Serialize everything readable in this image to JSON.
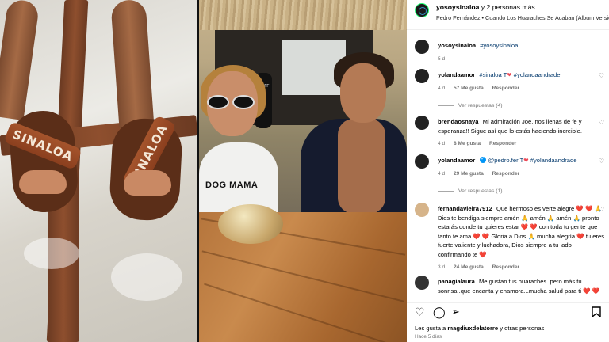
{
  "header": {
    "account": "yosoysinaloa",
    "others": "y 2 personas más",
    "audio": "Pedro Fernández • Cuando Los Huaraches Se Acaban (Album Version)"
  },
  "caption": {
    "user": "yosoysinaloa",
    "text": "#yosoysinaloa",
    "time": "5 d"
  },
  "comments": [
    {
      "user": "yolandaamor",
      "text_a": "#sinaloa T",
      "text_b": "#yolandaandrade",
      "time": "4 d",
      "likes": "57 Me gusta",
      "reply": "Responder",
      "replies": "Ver respuestas (4)"
    },
    {
      "user": "brendaosnaya",
      "text": "Mi admiración Joe, nos llenas de fe y esperanza!! Sigue así que lo estás haciendo increible.",
      "time": "4 d",
      "likes": "8 Me gusta",
      "reply": "Responder"
    },
    {
      "user": "yolandaamor",
      "text_a": "@pedro.fer T",
      "text_b": "#yolandaandrade",
      "time": "4 d",
      "likes": "29 Me gusta",
      "reply": "Responder",
      "replies": "Ver respuestas (1)"
    },
    {
      "user": "fernandavieira7912",
      "text": "Que hermoso es verte alegre ❤️ ❤️ 🙏 Dios te bendiga siempre amén 🙏 amén 🙏 amén 🙏 pronto estarás donde tu quieres estar ❤️ ❤️ con toda tu gente que tanto te ama ❤️ ❤️ Gloria a Dios 🙏 mucha alegría ❤️ tu eres fuerte valiente y luchadora, Dios siempre a tu lado confirmando te ❤️",
      "time": "3 d",
      "likes": "24 Me gusta",
      "reply": "Responder"
    },
    {
      "user": "panagialaura",
      "text": "Me gustan tus huaraches..pero más tu sonrisa..que encanta y enamora...mucha salud para ti ❤️ ❤️ ❤️ ❤️ ❤️"
    }
  ],
  "actions": {
    "like_icon": "heart-icon",
    "comment_icon": "comment-icon",
    "share_icon": "share-icon",
    "save_icon": "bookmark-icon"
  },
  "likes_line": {
    "prefix": "Les gusta a",
    "user": "magdiuxdelatorre",
    "suffix": "y otras personas"
  },
  "posted": "Hace 5 días",
  "media": {
    "sandal_left_text": "SINALOA",
    "sandal_right_text": "SINALOA",
    "shirt_text": "DOG MAMA",
    "staff_text": "STAFF"
  }
}
